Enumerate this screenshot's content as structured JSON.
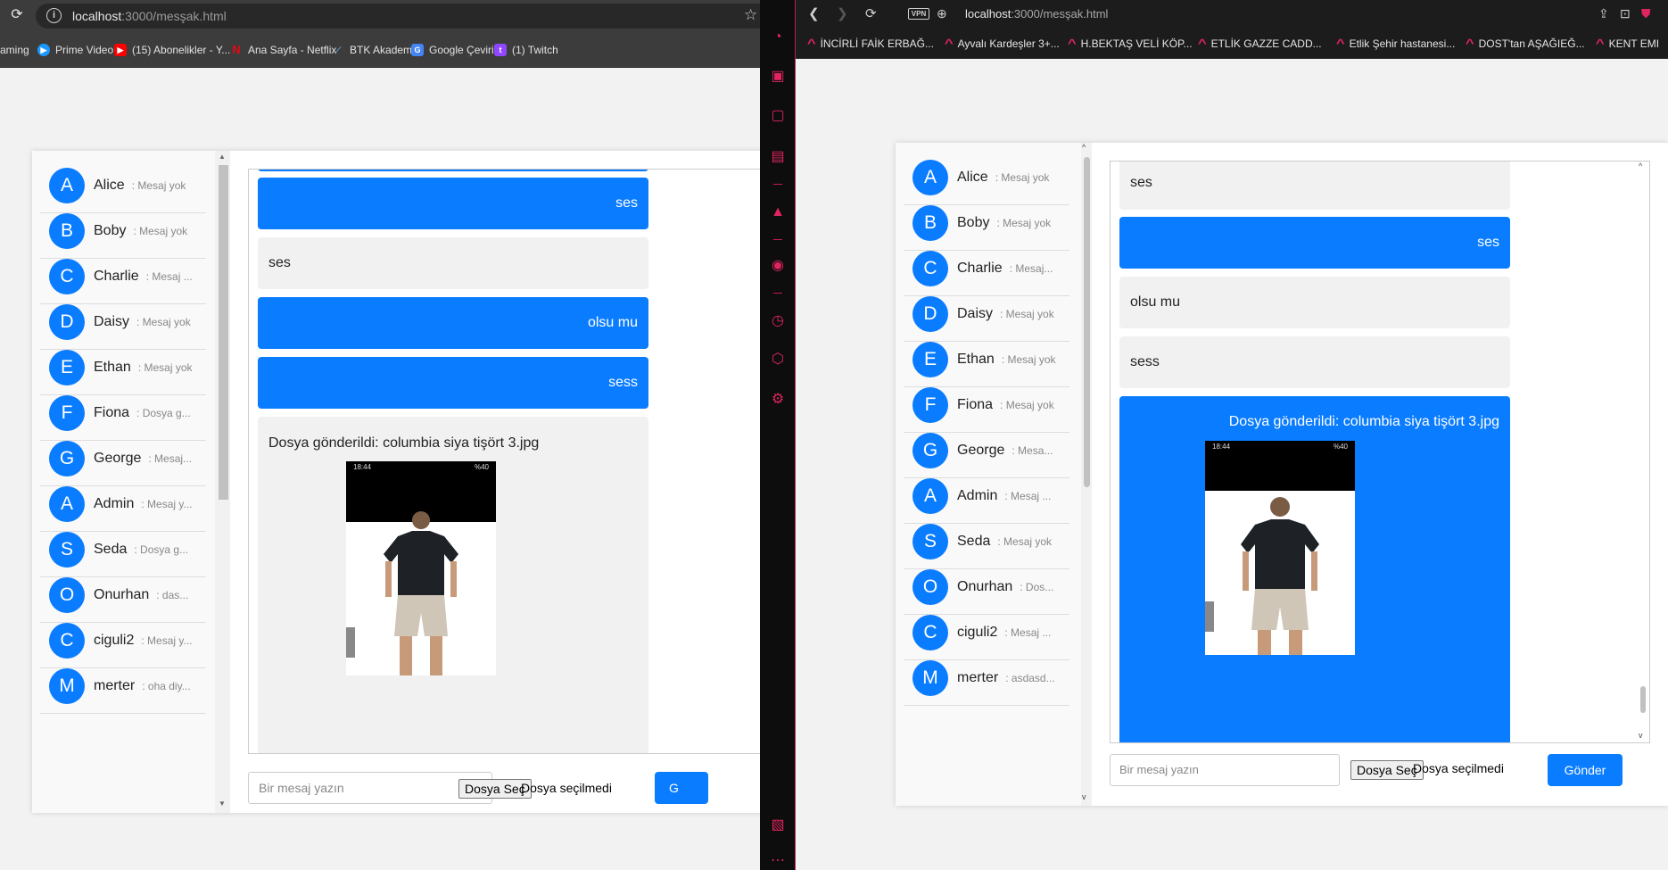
{
  "left_browser": {
    "url_host": "localhost",
    "url_rest": ":3000/mesşak.html",
    "bookmarks": [
      {
        "label": "aming",
        "icon": ""
      },
      {
        "label": "Prime Video",
        "icon": "prime-video-icon"
      },
      {
        "label": "(15) Abonelikler - Y...",
        "icon": "youtube-icon"
      },
      {
        "label": "Ana Sayfa - Netflix",
        "icon": "netflix-icon"
      },
      {
        "label": "BTK Akademi",
        "icon": "btk-icon"
      },
      {
        "label": "Google Çeviri",
        "icon": "google-translate-icon"
      },
      {
        "label": "(1) Twitch",
        "icon": "twitch-icon"
      }
    ]
  },
  "right_browser": {
    "url_host": "localhost",
    "url_rest": ":3000/mesşak.html",
    "vpn_label": "VPN",
    "bookmarks": [
      "İNCİRLİ FAİK ERBAĞ...",
      "Ayvalı Kardeşler 3+...",
      "H.BEKTAŞ VELİ KÖP...",
      "ETLİK GAZZE CADD...",
      "Etlik Şehir hastanesi...",
      "DOST'tan AŞAĞIEĞ...",
      "KENT EMI"
    ]
  },
  "left_chat": {
    "contacts": [
      {
        "initial": "A",
        "name": "Alice",
        "preview": ": Mesaj yok"
      },
      {
        "initial": "B",
        "name": "Boby",
        "preview": ": Mesaj yok"
      },
      {
        "initial": "C",
        "name": "Charlie",
        "preview": ": Mesaj ..."
      },
      {
        "initial": "D",
        "name": "Daisy",
        "preview": ": Mesaj yok"
      },
      {
        "initial": "E",
        "name": "Ethan",
        "preview": ": Mesaj yok"
      },
      {
        "initial": "F",
        "name": "Fiona",
        "preview": ": Dosya g..."
      },
      {
        "initial": "G",
        "name": "George",
        "preview": ": Mesaj..."
      },
      {
        "initial": "A",
        "name": "Admin",
        "preview": ": Mesaj y..."
      },
      {
        "initial": "S",
        "name": "Seda",
        "preview": ": Dosya g..."
      },
      {
        "initial": "O",
        "name": "Onurhan",
        "preview": ": das..."
      },
      {
        "initial": "C",
        "name": "ciguli2",
        "preview": ": Mesaj y..."
      },
      {
        "initial": "M",
        "name": "merter",
        "preview": ": oha diy..."
      }
    ],
    "messages": [
      {
        "from": "me",
        "text": "ses"
      },
      {
        "from": "them",
        "text": "ses"
      },
      {
        "from": "me",
        "text": "olsu mu"
      },
      {
        "from": "me",
        "text": "sess"
      },
      {
        "from": "them",
        "text": "Dosya gönderildi: columbia siya tişört 3.jpg"
      }
    ],
    "input_placeholder": "Bir mesaj yazın",
    "file_button": "Dosya Seç",
    "file_status": "Dosya seçilmedi",
    "send_label": "G"
  },
  "right_chat": {
    "contacts": [
      {
        "initial": "A",
        "name": "Alice",
        "preview": ": Mesaj yok"
      },
      {
        "initial": "B",
        "name": "Boby",
        "preview": ": Mesaj yok"
      },
      {
        "initial": "C",
        "name": "Charlie",
        "preview": ": Mesaj..."
      },
      {
        "initial": "D",
        "name": "Daisy",
        "preview": ": Mesaj yok"
      },
      {
        "initial": "E",
        "name": "Ethan",
        "preview": ": Mesaj yok"
      },
      {
        "initial": "F",
        "name": "Fiona",
        "preview": ": Mesaj yok"
      },
      {
        "initial": "G",
        "name": "George",
        "preview": ": Mesa..."
      },
      {
        "initial": "A",
        "name": "Admin",
        "preview": ": Mesaj ..."
      },
      {
        "initial": "S",
        "name": "Seda",
        "preview": ": Mesaj yok"
      },
      {
        "initial": "O",
        "name": "Onurhan",
        "preview": ": Dos..."
      },
      {
        "initial": "C",
        "name": "ciguli2",
        "preview": ": Mesaj ..."
      },
      {
        "initial": "M",
        "name": "merter",
        "preview": ": asdasd..."
      }
    ],
    "messages": [
      {
        "from": "them",
        "text": "ses"
      },
      {
        "from": "me",
        "text": "ses"
      },
      {
        "from": "them",
        "text": "olsu mu"
      },
      {
        "from": "them",
        "text": "sess"
      },
      {
        "from": "me",
        "text": "Dosya gönderildi: columbia siya tişört 3.jpg"
      }
    ],
    "input_placeholder": "Bir mesaj yazın",
    "file_button": "Dosya Seç",
    "file_status": "Dosya seçilmedi",
    "send_label": "Gönder"
  },
  "photo": {
    "status_time": "18:44",
    "status_icons": "%40"
  },
  "colors": {
    "accent": "#0a7cff",
    "opera_red": "#e0245e",
    "bubble_other": "#f1f1f1"
  }
}
